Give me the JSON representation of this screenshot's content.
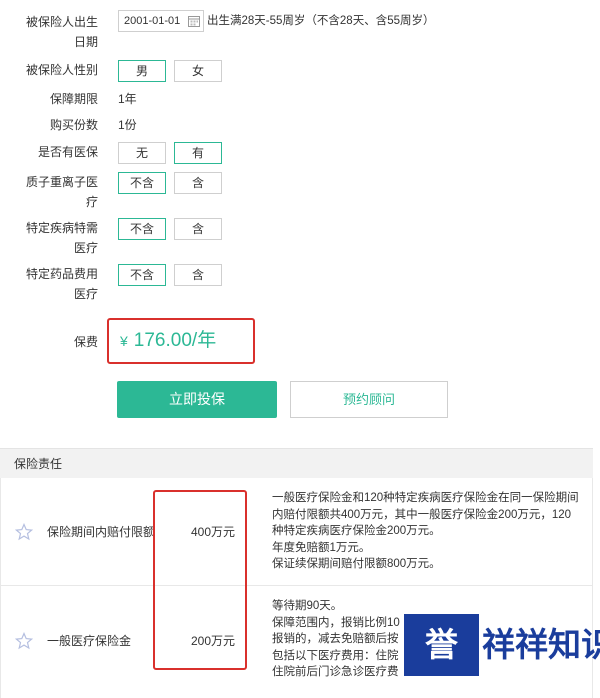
{
  "form": {
    "birth": {
      "label_line1": "被保险人出生",
      "label_line2": "日期",
      "date_value": "2001-01-01",
      "hint": "出生满28天-55周岁（不含28天、含55周岁）"
    },
    "gender": {
      "label": "被保险人性别",
      "options": [
        "男",
        "女"
      ],
      "selected": "男"
    },
    "period": {
      "label": "保障期限",
      "value": "1年"
    },
    "copies": {
      "label": "购买份数",
      "value": "1份"
    },
    "medical_insurance": {
      "label": "是否有医保",
      "options": [
        "无",
        "有"
      ],
      "selected": "有"
    },
    "proton_heavy_ion": {
      "label_line1": "质子重离子医",
      "label_line2": "疗",
      "options": [
        "不含",
        "含"
      ],
      "selected": "不含"
    },
    "special_disease": {
      "label_line1": "特定疾病特需",
      "label_line2": "医疗",
      "options": [
        "不含",
        "含"
      ],
      "selected": "不含"
    },
    "special_drug": {
      "label_line1": "特定药品费用",
      "label_line2": "医疗",
      "options": [
        "不含",
        "含"
      ],
      "selected": "不含"
    },
    "premium": {
      "label": "保费",
      "currency": "¥",
      "amount": "176.00/年"
    }
  },
  "actions": {
    "insure_label": "立即投保",
    "consult_label": "预约顾问"
  },
  "coverage": {
    "section_title": "保险责任",
    "rows": [
      {
        "name": "保险期间内赔付限额",
        "amount": "400万元",
        "desc": [
          "一般医疗保险金和120种特定疾病医疗保险金在同一保险期间",
          "内赔付限额共400万元，其中一般医疗保险金200万元，120",
          "种特定疾病医疗保险金200万元。",
          "年度免赔额1万元。",
          "保证续保期间赔付限额800万元。"
        ]
      },
      {
        "name": "一般医疗保险金",
        "amount": "200万元",
        "desc": [
          "等待期90天。",
          "保障范围内，报销比例10",
          "报销的，减去免赔额后按",
          "包括以下医疗费用：住院",
          "住院前后门诊急诊医疗费"
        ]
      }
    ]
  },
  "watermark": {
    "badge_text": "誉",
    "text": "祥祥知识"
  },
  "colors": {
    "accent": "#2cb895",
    "highlight_border": "#d9302c",
    "watermark_blue": "#1a3d9c"
  }
}
